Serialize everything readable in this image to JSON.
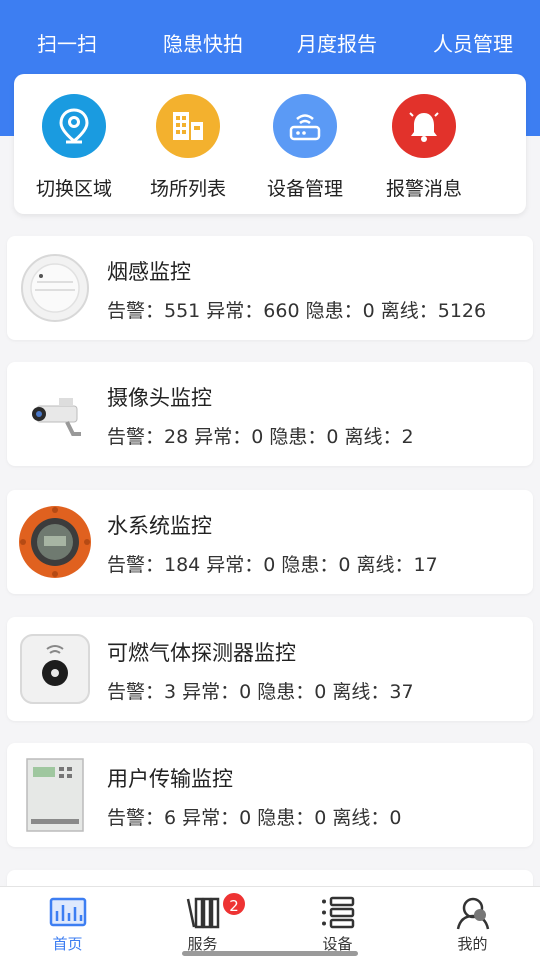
{
  "top_actions": [
    {
      "label": "扫一扫",
      "icon": "scan-icon"
    },
    {
      "label": "隐患快拍",
      "icon": "camera-icon"
    },
    {
      "label": "月度报告",
      "icon": "report-icon"
    },
    {
      "label": "人员管理",
      "icon": "people-icon"
    }
  ],
  "quick_actions": [
    {
      "label": "切换区域",
      "icon": "location-pin-icon",
      "color": "#1a9be0"
    },
    {
      "label": "场所列表",
      "icon": "building-icon",
      "color": "#f3b12e"
    },
    {
      "label": "设备管理",
      "icon": "router-icon",
      "color": "#5b9af5"
    },
    {
      "label": "报警消息",
      "icon": "bell-icon",
      "color": "#e2322b"
    }
  ],
  "monitors": [
    {
      "title": "烟感监控",
      "stats": "告警：551 异常：660 隐患：0 离线：5126",
      "icon": "smoke-detector-icon"
    },
    {
      "title": "摄像头监控",
      "stats": "告警：28 异常：0 隐患：0 离线：2",
      "icon": "camera-device-icon"
    },
    {
      "title": "水系统监控",
      "stats": "告警：184 异常：0 隐患：0 离线：17",
      "icon": "water-gauge-icon"
    },
    {
      "title": "可燃气体探测器监控",
      "stats": "告警：3 异常：0 隐患：0 离线：37",
      "icon": "gas-detector-icon"
    },
    {
      "title": "用户传输监控",
      "stats": "告警：6 异常：0 隐患：0 离线：0",
      "icon": "transmission-device-icon"
    }
  ],
  "tabs": [
    {
      "label": "首页",
      "icon": "home-chart-icon",
      "active": true
    },
    {
      "label": "服务",
      "icon": "books-icon",
      "badge": "2"
    },
    {
      "label": "设备",
      "icon": "device-list-icon"
    },
    {
      "label": "我的",
      "icon": "profile-icon"
    }
  ],
  "colors": {
    "primary": "#3d7ef2",
    "badge": "#e33333"
  }
}
